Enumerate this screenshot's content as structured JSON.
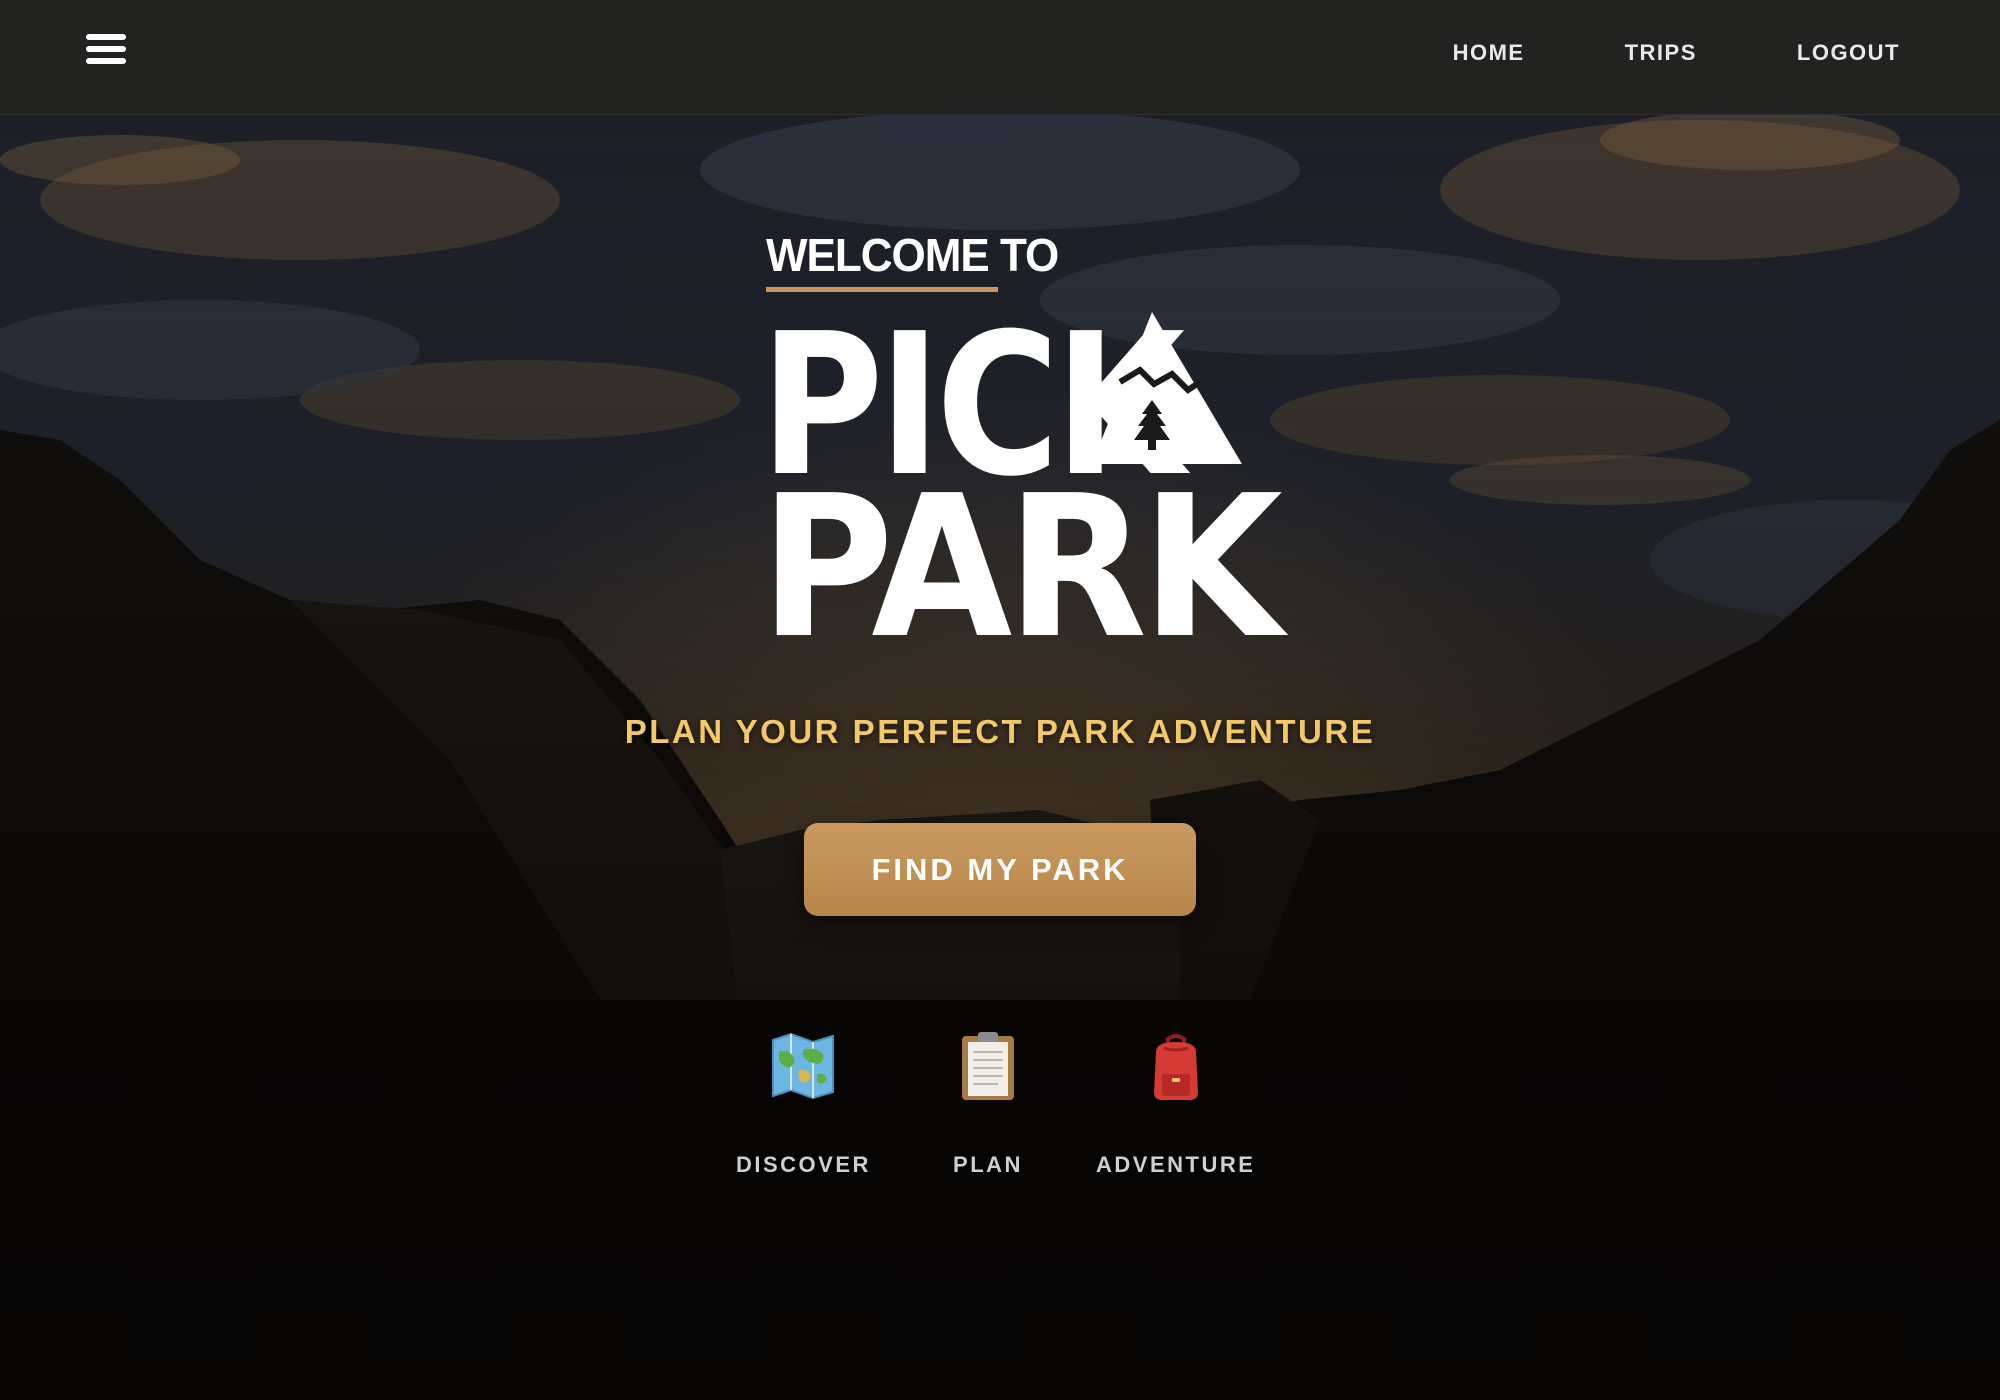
{
  "nav": {
    "menu_icon": "hamburger-menu-icon",
    "links": [
      {
        "label": "HOME"
      },
      {
        "label": "TRIPS"
      },
      {
        "label": "LOGOUT"
      }
    ]
  },
  "hero": {
    "logo": {
      "welcome": "WELCOME TO",
      "line1": "PICK",
      "line2": "PARK",
      "mountain_icon": "mountain-tree-icon"
    },
    "tagline": "PLAN YOUR PERFECT PARK ADVENTURE",
    "cta_label": "FIND MY PARK"
  },
  "features": [
    {
      "label": "DISCOVER",
      "icon": "world-map-icon"
    },
    {
      "label": "PLAN",
      "icon": "clipboard-icon"
    },
    {
      "label": "ADVENTURE",
      "icon": "backpack-icon"
    }
  ],
  "colors": {
    "accent": "#c8955b",
    "tagline": "#f2c868",
    "navbar": "#222221"
  }
}
